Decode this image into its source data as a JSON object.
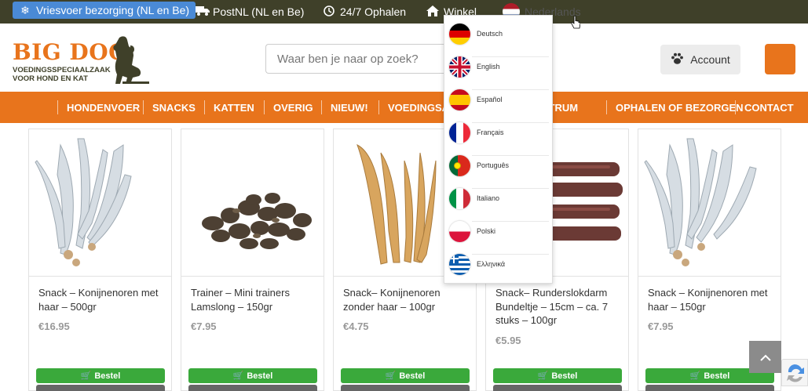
{
  "topbar": {
    "freeze": "Vriesvoer bezorging (NL en Be)",
    "postnl": "PostNL (NL en Be)",
    "pickup": "24/7 Ophalen",
    "shop": "Winkel",
    "language": "Nederlands"
  },
  "header": {
    "logo_main": "BIG DOG",
    "logo_line1": "VOEDINGSSPECIAALZAAK",
    "logo_line2": "VOOR HOND EN KAT",
    "search_placeholder": "Waar ben je naar op zoek?",
    "account": "Account"
  },
  "nav": [
    "HONDENVOER",
    "SNACKS",
    "KATTEN",
    "OVERIG",
    "NIEUW!",
    "VOEDINGSADVIES",
    "KENNISCENTRUM",
    "OPHALEN OF BEZORGEN",
    "CONTACT"
  ],
  "languages": [
    "Deutsch",
    "English",
    "Español",
    "Français",
    "Português",
    "Italiano",
    "Polski",
    "Ελληνικά"
  ],
  "products": [
    {
      "title": "Snack – Konijnenoren met haar – 500gr",
      "price": "€16.95",
      "button": "Bestel"
    },
    {
      "title": "Trainer – Mini trainers Lamslong – 150gr",
      "price": "€7.95",
      "button": "Bestel"
    },
    {
      "title": "Snack– Konijnenoren zonder haar – 100gr",
      "price": "€4.75",
      "button": "Bestel"
    },
    {
      "title": "Snack– Runderslokdarm Bundeltje – 15cm – ca. 7 stuks – 100gr",
      "price": "€5.95",
      "button": "Bestel"
    },
    {
      "title": "Snack – Konijnenoren met haar – 150gr",
      "price": "€7.95",
      "button": "Bestel"
    }
  ],
  "colors": {
    "topbar": "#3f4029",
    "accent": "#e8741c",
    "button": "#3aa93b",
    "freeze": "#4a8ad6"
  }
}
